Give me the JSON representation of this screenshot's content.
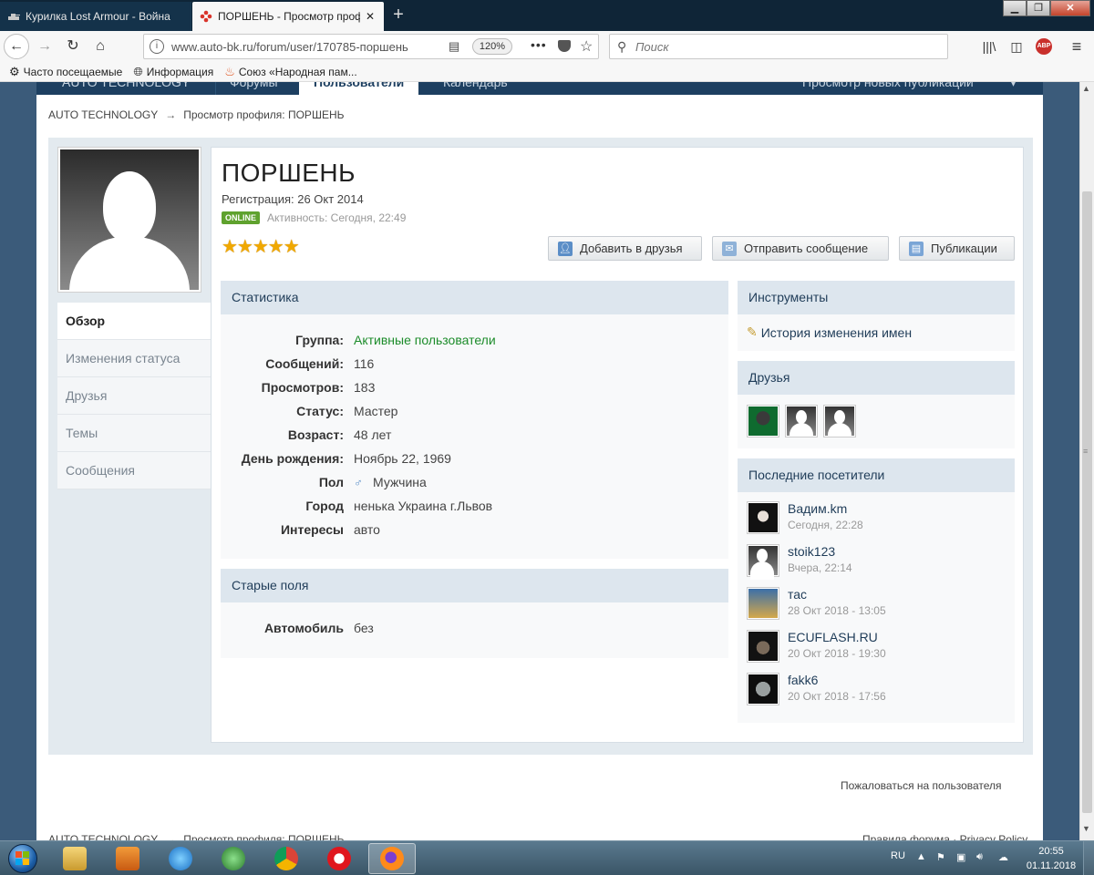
{
  "browser": {
    "tabs": [
      {
        "title": "Курилка Lost Armour - Война",
        "active": false
      },
      {
        "title": "ПОРШЕНЬ - Просмотр профи",
        "active": true
      }
    ],
    "new_tab": "+",
    "url": "www.auto-bk.ru/forum/user/170785-поршень",
    "zoom": "120%",
    "more": "•••",
    "search_placeholder": "Поиск",
    "abp": "ABP",
    "bookmarks": [
      {
        "label": "Часто посещаемые",
        "icon": "gear-icon"
      },
      {
        "label": "Информация",
        "icon": "globe-icon"
      },
      {
        "label": "Союз «Народная пам...",
        "icon": "flame-icon"
      }
    ]
  },
  "site": {
    "topnav": [
      {
        "label": "AUTO TECHNOLOGY"
      },
      {
        "label": "Форумы"
      },
      {
        "label": "Пользователи",
        "active": true
      },
      {
        "label": "Календарь"
      },
      {
        "label": "Просмотр новых публикаций"
      }
    ],
    "breadcrumb": [
      "AUTO TECHNOLOGY",
      "→",
      "Просмотр профиля: ПОРШЕНЬ"
    ]
  },
  "profile": {
    "username": "ПОРШЕНЬ",
    "registration": "Регистрация: 26 Окт 2014",
    "online_badge": "ONLINE",
    "activity": "Активность: Сегодня, 22:49",
    "stars": "★★★★★",
    "rating_stars": 5,
    "buttons": {
      "add_friend": "Добавить в друзья",
      "send_message": "Отправить сообщение",
      "posts": "Публикации"
    },
    "side_nav": [
      "Обзор",
      "Изменения статуса",
      "Друзья",
      "Темы",
      "Сообщения"
    ],
    "stats_title": "Статистика",
    "stats": [
      {
        "key": "Группа:",
        "value": "Активные пользователи"
      },
      {
        "key": "Сообщений:",
        "value": "116"
      },
      {
        "key": "Просмотров:",
        "value": "183"
      },
      {
        "key": "Статус:",
        "value": "Мастер"
      },
      {
        "key": "Возраст:",
        "value": "48 лет"
      },
      {
        "key": "День рождения:",
        "value": "Ноябрь 22, 1969"
      },
      {
        "key": "Пол",
        "value": "Мужчина"
      },
      {
        "key": "Город",
        "value": "ненька Украина г.Львов"
      },
      {
        "key": "Интересы",
        "value": "авто"
      }
    ],
    "old_fields_title": "Старые поля",
    "old_fields": [
      {
        "key": "Автомобиль",
        "value": "без"
      }
    ],
    "tools_title": "Инструменты",
    "tools_link": "История изменения имен",
    "friends_title": "Друзья",
    "visitors_title": "Последние посетители",
    "visitors": [
      {
        "name": "Вадим.km",
        "time": "Сегодня, 22:28"
      },
      {
        "name": "stoik123",
        "time": "Вчера, 22:14"
      },
      {
        "name": "тас",
        "time": "28 Окт 2018 - 13:05"
      },
      {
        "name": "ECUFLASH.RU",
        "time": "20 Окт 2018 - 19:30"
      },
      {
        "name": "fakk6",
        "time": "20 Окт 2018 - 17:56"
      }
    ],
    "report": "Пожаловаться на пользователя"
  },
  "footer": {
    "crumb": [
      "AUTO TECHNOLOGY",
      "→",
      "Просмотр профиля: ПОРШЕНЬ"
    ],
    "links": "Правила форума · Privacy Policy"
  },
  "taskbar": {
    "lang": "RU",
    "time": "20:55",
    "date": "01.11.2018"
  }
}
